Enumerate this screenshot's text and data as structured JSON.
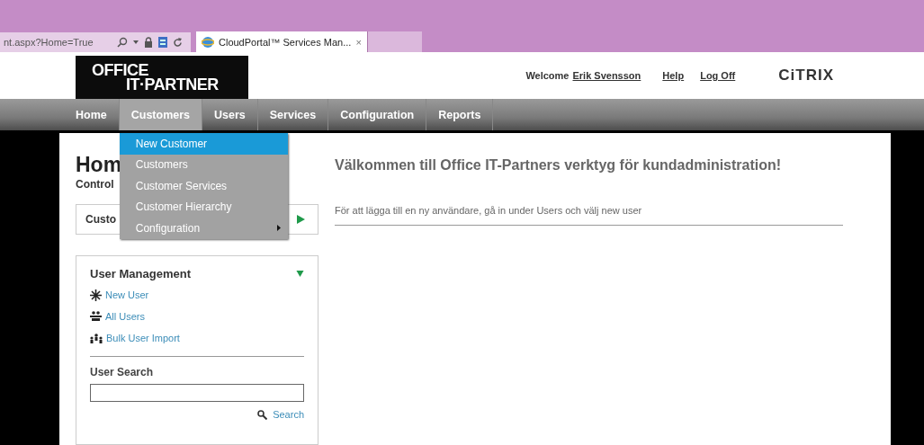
{
  "browser": {
    "address": "nt.aspx?Home=True",
    "tab": {
      "title": "CloudPortal™ Services Man...",
      "close": "×"
    }
  },
  "header": {
    "logo": {
      "line1": "OFFICE",
      "line2": "IT·PARTNER"
    },
    "welcome": "Welcome",
    "user": "Erik Svensson",
    "links": [
      "Help",
      "Log Off"
    ],
    "brand": "CiTRIX"
  },
  "nav": [
    {
      "label": "Home",
      "selected": false
    },
    {
      "label": "Customers",
      "selected": true
    },
    {
      "label": "Users",
      "selected": false
    },
    {
      "label": "Services",
      "selected": false
    },
    {
      "label": "Configuration",
      "selected": false
    },
    {
      "label": "Reports",
      "selected": false
    }
  ],
  "dropdown": [
    {
      "label": "New Customer",
      "selected": true,
      "submenu": false
    },
    {
      "label": "Customers",
      "selected": false,
      "submenu": false
    },
    {
      "label": "Customer Services",
      "selected": false,
      "submenu": false
    },
    {
      "label": "Customer Hierarchy",
      "selected": false,
      "submenu": false
    },
    {
      "label": "Configuration",
      "selected": false,
      "submenu": true
    }
  ],
  "page": {
    "title": "Hom",
    "subtitle": "Control"
  },
  "customer_panel": {
    "title": "Custo",
    "expanded": false
  },
  "user_panel": {
    "title": "User Management",
    "expanded": true,
    "items": [
      {
        "kind": "new",
        "label": "New User"
      },
      {
        "kind": "all",
        "label": "All Users"
      },
      {
        "kind": "bulk",
        "label": "Bulk User Import"
      }
    ],
    "search_label": "User Search",
    "search_button": "Search"
  },
  "main": {
    "heading": "Välkommen till Office IT-Partners verktyg för kundadministration!",
    "text": "För att lägga till en ny användare, gå in under Users och välj new user"
  }
}
